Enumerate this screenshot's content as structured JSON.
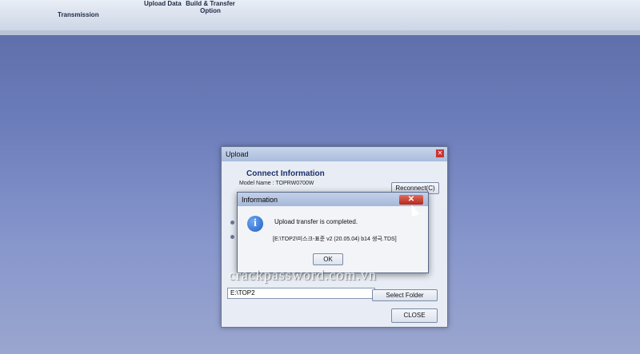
{
  "ribbon": {
    "items": [
      {
        "label": "Transmission"
      },
      {
        "label": "Upload Data"
      },
      {
        "label": "Build & Transfer Option"
      }
    ]
  },
  "upload_window": {
    "title": "Upload",
    "section_title": "Connect Information",
    "model_name": "Model Name : TOPRW0700W",
    "reconnect_label": "Reconnect(C)",
    "folder_path": "E:\\TOP2",
    "select_folder_label": "Select Folder",
    "close_label": "CLOSE"
  },
  "info_dialog": {
    "title": "Information",
    "message": "Upload transfer is completed.",
    "path_line": "[E:\\TOP2\\미스크-표준 v2 (20.05.04) b14 생극.TDS]",
    "ok_label": "OK",
    "close_icon": "close-icon"
  },
  "watermark": "crackpassword.com.vn",
  "colors": {
    "desktop": "#6c7dbb",
    "dialog_close": "#c0392b",
    "info_icon": "#1f5ec4"
  }
}
